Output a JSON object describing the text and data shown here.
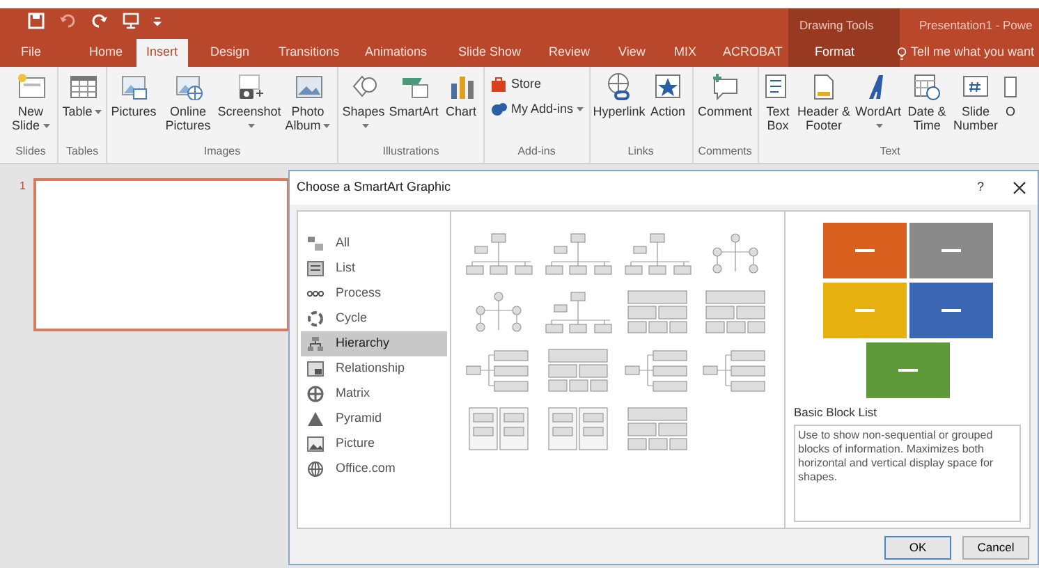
{
  "title_bar": {
    "context_group": "Drawing Tools",
    "title": "Presentation1 - Powe"
  },
  "tabs": [
    {
      "label": "File",
      "selected": false,
      "kind": "normal"
    },
    {
      "label": "Home",
      "selected": false,
      "kind": "normal"
    },
    {
      "label": "Insert",
      "selected": true,
      "kind": "normal"
    },
    {
      "label": "Design",
      "selected": false,
      "kind": "normal"
    },
    {
      "label": "Transitions",
      "selected": false,
      "kind": "normal"
    },
    {
      "label": "Animations",
      "selected": false,
      "kind": "normal"
    },
    {
      "label": "Slide Show",
      "selected": false,
      "kind": "normal"
    },
    {
      "label": "Review",
      "selected": false,
      "kind": "normal"
    },
    {
      "label": "View",
      "selected": false,
      "kind": "normal"
    },
    {
      "label": "MIX",
      "selected": false,
      "kind": "normal"
    },
    {
      "label": "ACROBAT",
      "selected": false,
      "kind": "normal"
    },
    {
      "label": "Format",
      "selected": false,
      "kind": "context"
    }
  ],
  "tell_me": {
    "placeholder": "Tell me what you want"
  },
  "ribbon_groups": [
    {
      "label": "Slides",
      "buttons": [
        {
          "label": "New Slide",
          "dropdown": true,
          "kind": "large"
        }
      ]
    },
    {
      "label": "Tables",
      "buttons": [
        {
          "label": "Table",
          "dropdown": true,
          "kind": "large"
        }
      ]
    },
    {
      "label": "Images",
      "buttons": [
        {
          "label": "Pictures",
          "dropdown": false,
          "kind": "large"
        },
        {
          "label": "Online Pictures",
          "dropdown": false,
          "kind": "large"
        },
        {
          "label": "Screenshot",
          "dropdown": true,
          "kind": "large"
        },
        {
          "label": "Photo Album",
          "dropdown": true,
          "kind": "large"
        }
      ]
    },
    {
      "label": "Illustrations",
      "buttons": [
        {
          "label": "Shapes",
          "dropdown": true,
          "kind": "large"
        },
        {
          "label": "SmartArt",
          "dropdown": false,
          "kind": "large"
        },
        {
          "label": "Chart",
          "dropdown": false,
          "kind": "large"
        }
      ]
    },
    {
      "label": "Add-ins",
      "buttons": [
        {
          "label": "Store",
          "dropdown": false,
          "kind": "small"
        },
        {
          "label": "My Add-ins",
          "dropdown": true,
          "kind": "small"
        }
      ]
    },
    {
      "label": "Links",
      "buttons": [
        {
          "label": "Hyperlink",
          "dropdown": false,
          "kind": "large"
        },
        {
          "label": "Action",
          "dropdown": false,
          "kind": "large"
        }
      ]
    },
    {
      "label": "Comments",
      "buttons": [
        {
          "label": "Comment",
          "dropdown": false,
          "kind": "large"
        }
      ]
    },
    {
      "label": "Text",
      "buttons": [
        {
          "label": "Text Box",
          "dropdown": false,
          "kind": "large"
        },
        {
          "label": "Header & Footer",
          "dropdown": false,
          "kind": "large"
        },
        {
          "label": "WordArt",
          "dropdown": true,
          "kind": "large"
        },
        {
          "label": "Date & Time",
          "dropdown": false,
          "kind": "large"
        },
        {
          "label": "Slide Number",
          "dropdown": false,
          "kind": "large"
        },
        {
          "label": "O",
          "dropdown": false,
          "kind": "large"
        }
      ]
    }
  ],
  "slides": [
    {
      "number": "1",
      "selected": true
    }
  ],
  "dialog": {
    "title": "Choose a SmartArt Graphic",
    "help": "?",
    "categories": [
      {
        "label": "All",
        "selected": false
      },
      {
        "label": "List",
        "selected": false
      },
      {
        "label": "Process",
        "selected": false
      },
      {
        "label": "Cycle",
        "selected": false
      },
      {
        "label": "Hierarchy",
        "selected": true
      },
      {
        "label": "Relationship",
        "selected": false
      },
      {
        "label": "Matrix",
        "selected": false
      },
      {
        "label": "Pyramid",
        "selected": false
      },
      {
        "label": "Picture",
        "selected": false
      },
      {
        "label": "Office.com",
        "selected": false
      }
    ],
    "layouts": [
      {
        "selected": false
      },
      {
        "selected": false
      },
      {
        "selected": false
      },
      {
        "selected": false
      },
      {
        "selected": false
      },
      {
        "selected": false
      },
      {
        "selected": false
      },
      {
        "selected": false
      },
      {
        "selected": false
      },
      {
        "selected": false
      },
      {
        "selected": false
      },
      {
        "selected": false
      },
      {
        "selected": false
      },
      {
        "selected": false
      },
      {
        "selected": false
      }
    ],
    "preview": {
      "name": "Basic Block List",
      "description": "Use to show non-sequential or grouped blocks of information. Maximizes both horizontal and vertical display space for shapes.",
      "blocks": [
        {
          "color": "#d9601e"
        },
        {
          "color": "#8a8a8a"
        },
        {
          "color": "#e6b00f"
        },
        {
          "color": "#3a66b3"
        },
        {
          "color": "#5e9a3a"
        }
      ]
    },
    "buttons": [
      {
        "label": "OK",
        "kind": "default"
      },
      {
        "label": "Cancel",
        "kind": "normal"
      }
    ]
  }
}
